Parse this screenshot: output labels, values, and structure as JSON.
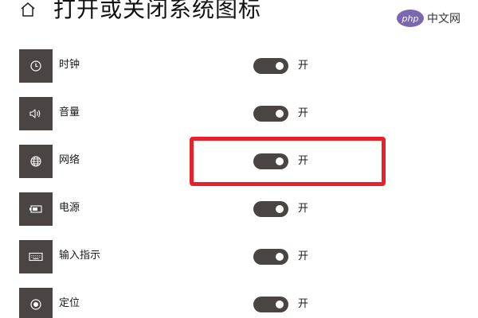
{
  "header": {
    "title": "打开或关闭系统图标",
    "home_icon": "home-icon"
  },
  "watermark": {
    "badge_text": "php",
    "site_text": "中文网"
  },
  "system_icons": [
    {
      "label": "时钟",
      "icon": "clock-icon",
      "state_label": "开",
      "enabled": true
    },
    {
      "label": "音量",
      "icon": "volume-icon",
      "state_label": "开",
      "enabled": true
    },
    {
      "label": "网络",
      "icon": "network-globe-icon",
      "state_label": "开",
      "enabled": true,
      "highlighted": true
    },
    {
      "label": "电源",
      "icon": "battery-icon",
      "state_label": "开",
      "enabled": true
    },
    {
      "label": "输入指示",
      "icon": "keyboard-icon",
      "state_label": "开",
      "enabled": true
    },
    {
      "label": "定位",
      "icon": "location-icon",
      "state_label": "开",
      "enabled": true
    }
  ],
  "colors": {
    "tile_background": "#4a4542",
    "toggle_on": "#4a4542",
    "highlight_border": "#e8202a",
    "watermark_badge": "#7b68b0"
  }
}
